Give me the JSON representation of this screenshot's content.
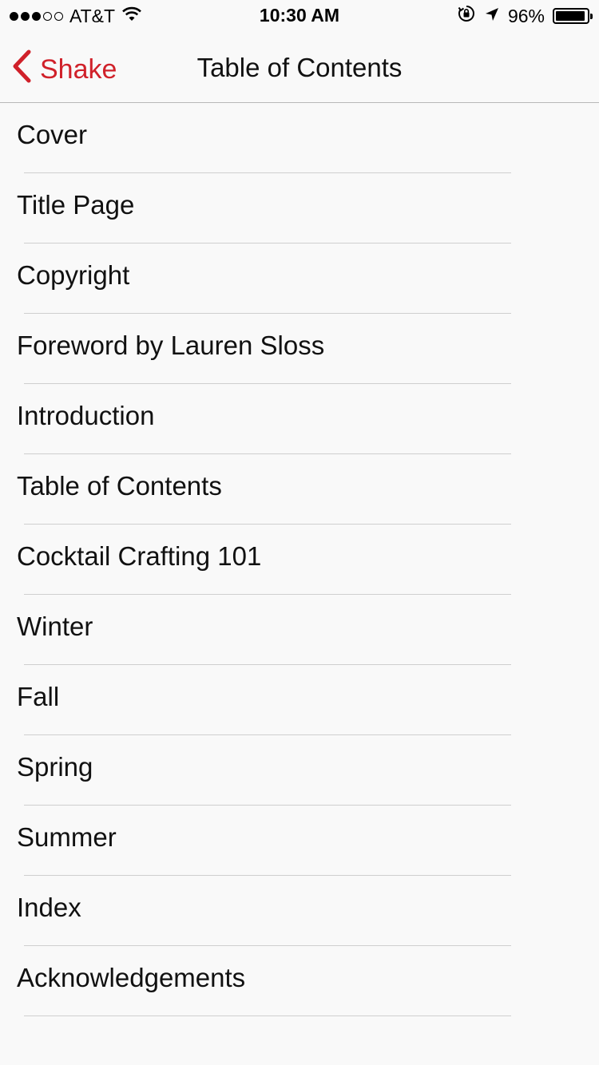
{
  "status_bar": {
    "carrier": "AT&T",
    "time": "10:30 AM",
    "battery_percent": "96%",
    "battery_level": 0.96,
    "signal_bars_filled": 3,
    "signal_bars_total": 5
  },
  "nav": {
    "back_label": "Shake",
    "title": "Table of Contents",
    "accent_color": "#d0212a"
  },
  "toc": {
    "items": [
      {
        "label": "Cover"
      },
      {
        "label": "Title Page"
      },
      {
        "label": "Copyright"
      },
      {
        "label": "Foreword by Lauren Sloss"
      },
      {
        "label": "Introduction"
      },
      {
        "label": "Table of Contents"
      },
      {
        "label": "Cocktail Crafting 101"
      },
      {
        "label": "Winter"
      },
      {
        "label": "Fall"
      },
      {
        "label": "Spring"
      },
      {
        "label": "Summer"
      },
      {
        "label": "Index"
      },
      {
        "label": "Acknowledgements"
      }
    ]
  }
}
